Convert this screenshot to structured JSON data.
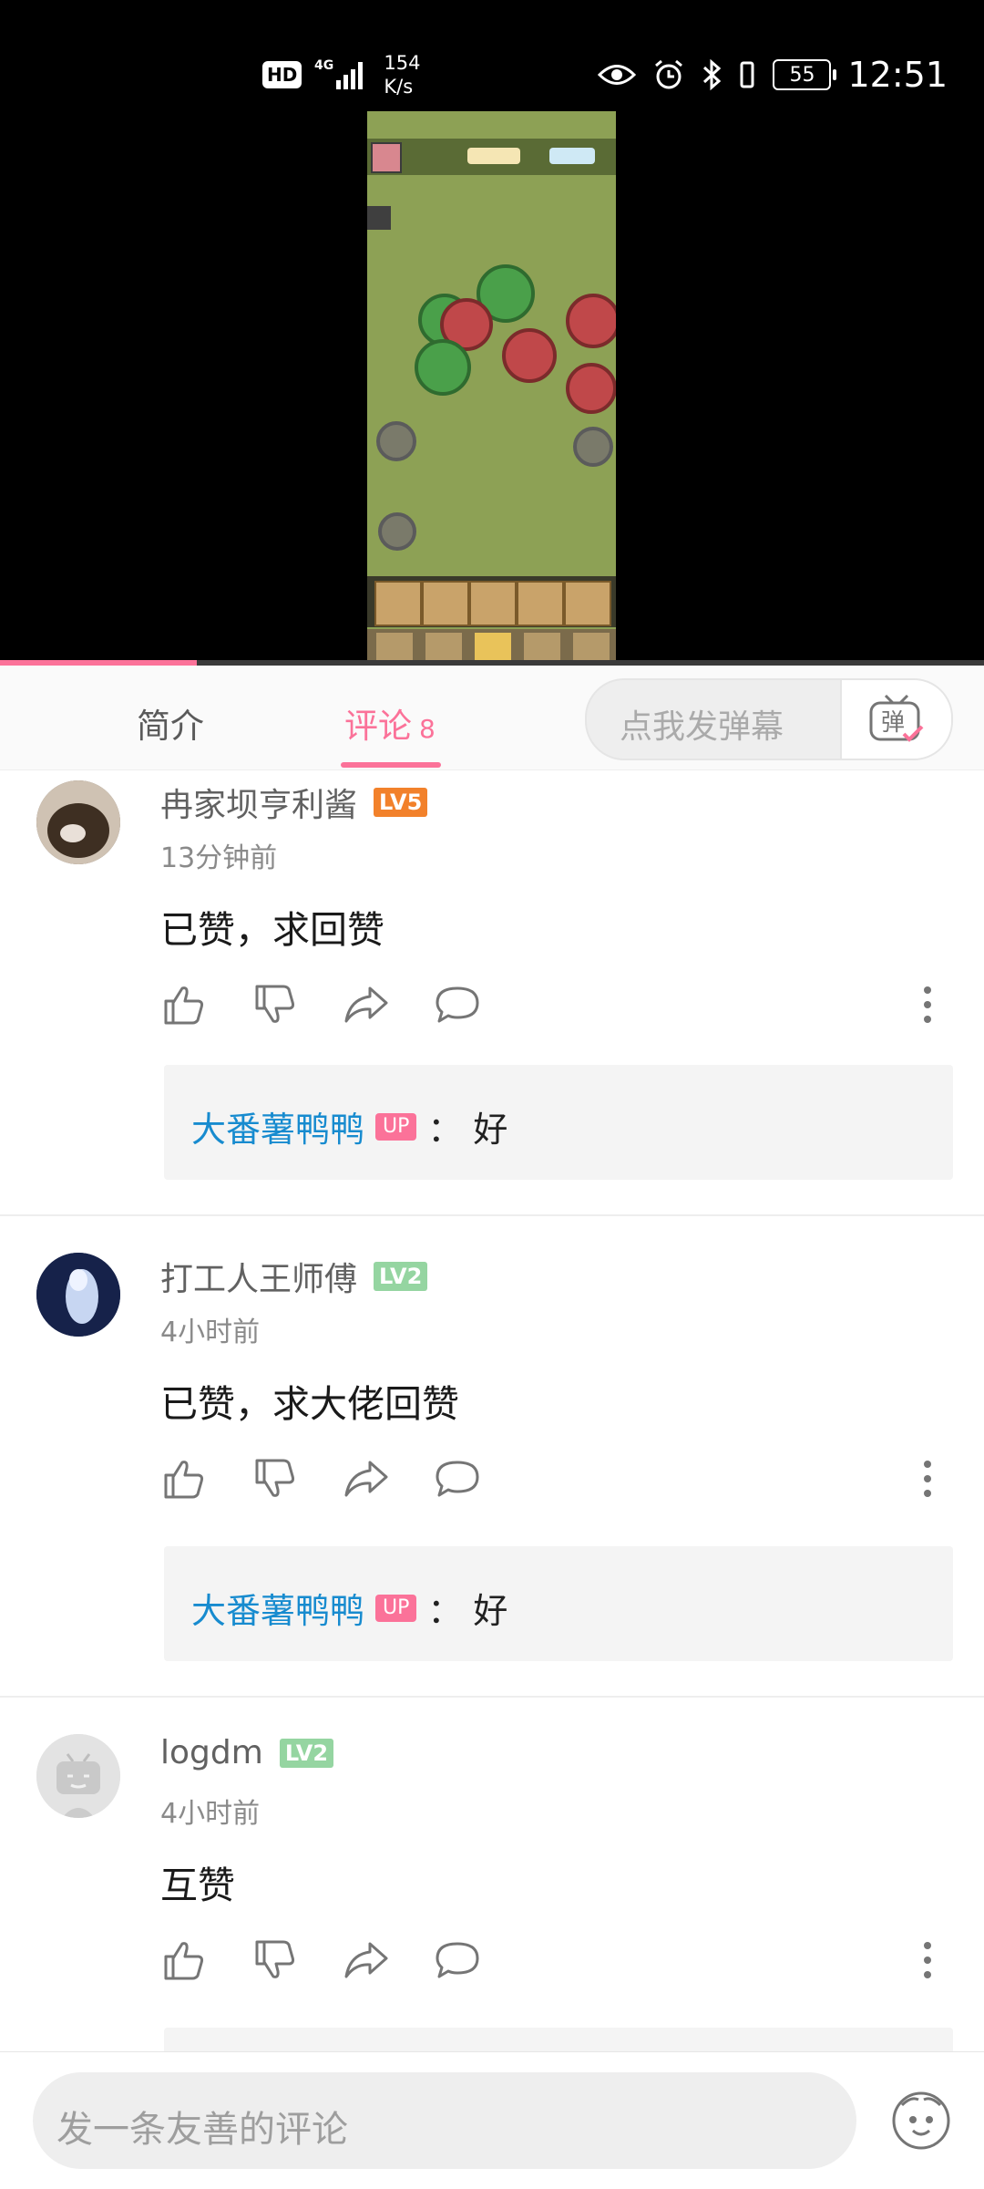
{
  "status_bar": {
    "hd": "HD",
    "signal": "4G",
    "speed_value": "154",
    "speed_unit": "K/s",
    "battery": "55",
    "time": "12:51"
  },
  "video": {
    "progress": 0.2
  },
  "tabs": {
    "intro": "简介",
    "comments": "评论",
    "comments_count": "8"
  },
  "danmaku": {
    "placeholder": "点我发弹幕",
    "button_glyph": "弹"
  },
  "comments": [
    {
      "username": "冉家坝亨利酱",
      "level": "LV5",
      "level_color": "#f2812b",
      "time": "13分钟前",
      "text": "已赞，求回赞",
      "reply": {
        "user": "大番薯鸭鸭",
        "badge": "UP",
        "sep": "：",
        "text": "好"
      }
    },
    {
      "username": "打工人王师傅",
      "level": "LV2",
      "level_color": "#95d5a1",
      "time": "4小时前",
      "text": "已赞，求大佬回赞",
      "reply": {
        "user": "大番薯鸭鸭",
        "badge": "UP",
        "sep": "：",
        "text": "好"
      }
    },
    {
      "username": "logdm",
      "level": "LV2",
      "level_color": "#95d5a1",
      "time": "4小时前",
      "text": "互赞"
    }
  ],
  "bottom_bar": {
    "placeholder": "发一条友善的评论"
  },
  "colors": {
    "accent": "#fb7299",
    "link": "#178bcf"
  }
}
